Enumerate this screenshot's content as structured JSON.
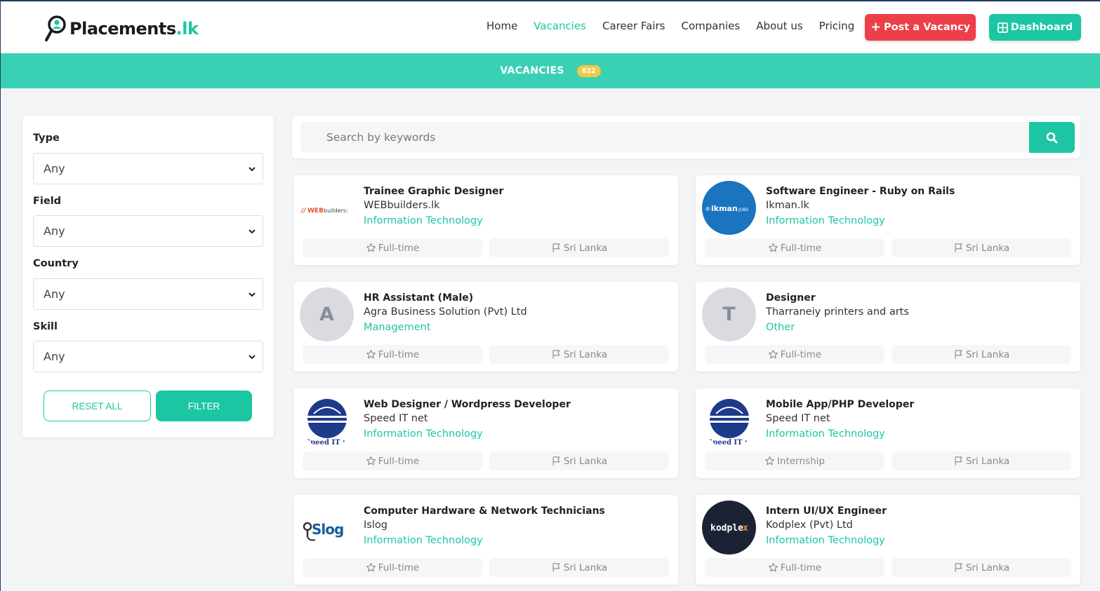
{
  "brand": {
    "name": "Placements",
    "tld": ".lk"
  },
  "nav": {
    "items": [
      {
        "label": "Home",
        "active": false
      },
      {
        "label": "Vacancies",
        "active": true
      },
      {
        "label": "Career Fairs",
        "active": false
      },
      {
        "label": "Companies",
        "active": false
      },
      {
        "label": "About us",
        "active": false
      },
      {
        "label": "Pricing",
        "active": false
      }
    ],
    "post_label": "Post a Vacancy",
    "dashboard_label": "Dashboard"
  },
  "banner": {
    "title": "VACANCIES",
    "count": "822"
  },
  "filters": {
    "type": {
      "label": "Type",
      "value": "Any"
    },
    "field": {
      "label": "Field",
      "value": "Any"
    },
    "country": {
      "label": "Country",
      "value": "Any"
    },
    "skill": {
      "label": "Skill",
      "value": "Any"
    },
    "reset_label": "RESET ALL",
    "filter_label": "FILTER"
  },
  "search": {
    "placeholder": "Search by keywords"
  },
  "jobs": [
    {
      "title": "Trainee Graphic Designer",
      "company": "WEBbuilders.lk",
      "field": "Information Technology",
      "type": "Full-time",
      "location": "Sri Lanka",
      "logo": "webbuilders-logo",
      "logo_text": "//WEBbuilders:"
    },
    {
      "title": "Software Engineer - Ruby on Rails",
      "company": "Ikman.lk",
      "field": "Information Technology",
      "type": "Full-time",
      "location": "Sri Lanka",
      "logo": "ikman-logo",
      "logo_text": "ikman",
      "logo_sub": "JOBS"
    },
    {
      "title": "HR Assistant (Male)",
      "company": "Agra Business Solution (Pvt) Ltd",
      "field": "Management",
      "type": "Full-time",
      "location": "Sri Lanka",
      "logo": "initial",
      "logo_text": "A"
    },
    {
      "title": "Designer",
      "company": "Tharraneiy printers and arts",
      "field": "Other",
      "type": "Full-time",
      "location": "Sri Lanka",
      "logo": "initial",
      "logo_text": "T"
    },
    {
      "title": "Web Designer / Wordpress Developer",
      "company": "Speed IT net",
      "field": "Information Technology",
      "type": "Full-time",
      "location": "Sri Lanka",
      "logo": "speedit-logo",
      "logo_text": "Speed IT net"
    },
    {
      "title": "Mobile App/PHP Developer",
      "company": "Speed IT net",
      "field": "Information Technology",
      "type": "Internship",
      "location": "Sri Lanka",
      "logo": "speedit-logo",
      "logo_text": "Speed IT net"
    },
    {
      "title": "Computer Hardware & Network Technicians",
      "company": "Islog",
      "field": "Information Technology",
      "type": "Full-time",
      "location": "Sri Lanka",
      "logo": "islog-logo",
      "logo_text": "Slog"
    },
    {
      "title": "Intern UI/UX Engineer",
      "company": "Kodplex (Pvt) Ltd",
      "field": "Information Technology",
      "type": "Full-time",
      "location": "Sri Lanka",
      "logo": "kodplex-logo",
      "logo_text": "kodplex"
    }
  ],
  "colors": {
    "accent": "#1cc6a2",
    "danger": "#ec3f48",
    "banner": "#39d1b3",
    "badge": "#f6c845"
  }
}
